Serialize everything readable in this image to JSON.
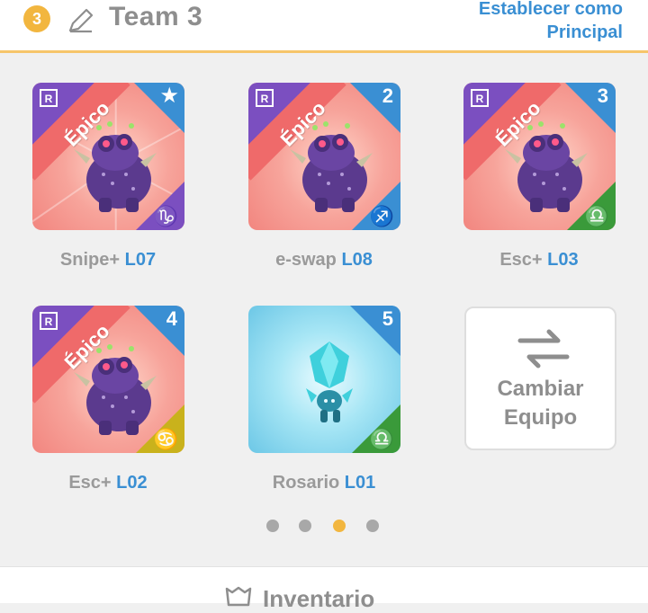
{
  "header": {
    "team_number": "3",
    "team_name": "Team 3",
    "set_main_line1": "Establecer como",
    "set_main_line2": "Principal"
  },
  "monsters": [
    {
      "rarity": "Épico",
      "rarity_letter": "R",
      "slot": "★",
      "zodiac": "♑",
      "zodiac_color": "#7b4fc0",
      "name": "Snipe+",
      "level": "L07"
    },
    {
      "rarity": "Épico",
      "rarity_letter": "R",
      "slot": "2",
      "zodiac": "♐",
      "zodiac_color": "#3a8fd3",
      "name": "e-swap",
      "level": "L08"
    },
    {
      "rarity": "Épico",
      "rarity_letter": "R",
      "slot": "3",
      "zodiac": "♎",
      "zodiac_color": "#3a9a3a",
      "name": "Esc+",
      "level": "L03"
    },
    {
      "rarity": "Épico",
      "rarity_letter": "R",
      "slot": "4",
      "zodiac": "♋",
      "zodiac_color": "#c9b21c",
      "name": "Esc+",
      "level": "L02"
    },
    {
      "rarity": "",
      "rarity_letter": "",
      "slot": "5",
      "zodiac": "♎",
      "zodiac_color": "#3a9a3a",
      "name": "Rosario",
      "level": "L01"
    }
  ],
  "switch_team": {
    "line1": "Cambiar",
    "line2": "Equipo"
  },
  "pagination": {
    "total": 4,
    "active_index": 2
  },
  "bottom": {
    "inventory_label": "Inventario"
  },
  "colors": {
    "accent_blue": "#3a8fd3",
    "accent_orange": "#f2b63f",
    "epic_purple": "#7b4fc0",
    "epic_red": "#ef6a6a"
  }
}
